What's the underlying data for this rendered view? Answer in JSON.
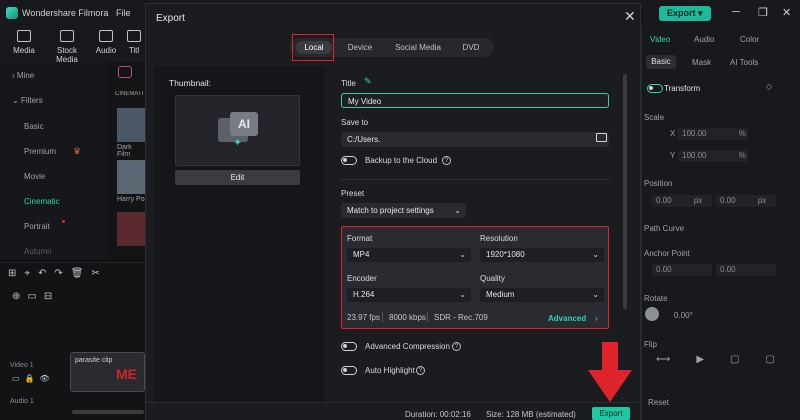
{
  "app": {
    "name": "Wondershare Filmora",
    "file_menu": "File",
    "export_button": "Export"
  },
  "toolbar": [
    "Media",
    "Stock Media",
    "Audio",
    "Titl"
  ],
  "left_panel": {
    "items": [
      {
        "label": "Mine",
        "active": false
      },
      {
        "label": "Filters",
        "active": false
      },
      {
        "label": "Basic",
        "active": false
      },
      {
        "label": "Premium",
        "active": false
      },
      {
        "label": "Movie",
        "active": false
      },
      {
        "label": "Cinematic",
        "active": true
      },
      {
        "label": "Portrait",
        "active": false
      },
      {
        "label": "Autumn",
        "active": false
      }
    ],
    "grid_label": "CINEMATI",
    "thumbs": [
      "Dark Film",
      "Harry Po"
    ]
  },
  "timeline": {
    "tracks": [
      "Video 1",
      "Audio 1"
    ],
    "clip_label": "parasite clip",
    "clip_text": "ME"
  },
  "right_panel": {
    "tabs": [
      "Video",
      "Audio",
      "Color"
    ],
    "subtabs": [
      "Basic",
      "Mask",
      "AI Tools"
    ],
    "section": "Transform",
    "scale_label": "Scale",
    "scale_x": "100.00",
    "scale_y": "100.00",
    "unit": "%",
    "position_label": "Position",
    "pos_x": "0.00",
    "pos_y": "0.00",
    "pos_unit": "px",
    "path_curve": "Path Curve",
    "anchor_label": "Anchor Point",
    "anchor_x": "0.00",
    "anchor_y": "0.00",
    "rotate_label": "Rotate",
    "rotate_value": "0.00°",
    "flip_label": "Flip",
    "reset": "Reset"
  },
  "modal": {
    "title": "Export",
    "tabs": [
      {
        "label": "Local",
        "active": true
      },
      {
        "label": "Device",
        "active": false
      },
      {
        "label": "Social Media",
        "active": false
      },
      {
        "label": "DVD",
        "active": false
      }
    ],
    "thumbnail_label": "Thumbnail:",
    "thumbnail_badge": "AI",
    "edit_button": "Edit",
    "title_label": "Title",
    "title_value": "My Video",
    "save_to_label": "Save to",
    "save_to_value": "C:/Users.",
    "backup_label": "Backup to the Cloud",
    "preset_label": "Preset",
    "preset_value": "Match to project settings",
    "format_label": "Format",
    "format_value": "MP4",
    "resolution_label": "Resolution",
    "resolution_value": "1920*1080",
    "encoder_label": "Encoder",
    "encoder_value": "H.264",
    "quality_label": "Quality",
    "quality_value": "Medium",
    "fps": "23.97 fps",
    "bitrate": "8000 kbps",
    "color_space": "SDR - Rec.709",
    "advanced": "Advanced",
    "options": [
      "Advanced Compression",
      "Auto Highlight"
    ],
    "duration_label": "Duration:",
    "duration": "00:02:16",
    "size_label": "Size:",
    "size": "128 MB (estimated)",
    "export_button": "Export"
  },
  "colors": {
    "accent": "#1fc7a4",
    "highlight": "#e0242c"
  }
}
